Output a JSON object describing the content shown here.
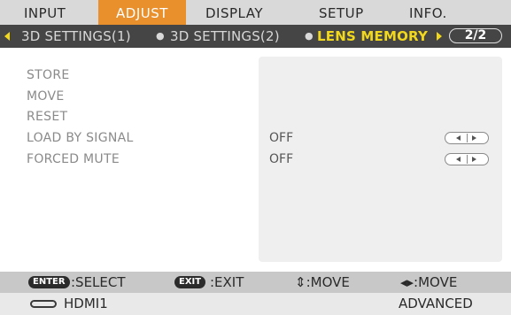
{
  "tabs": [
    {
      "label": "INPUT",
      "active": false
    },
    {
      "label": "ADJUST",
      "active": true
    },
    {
      "label": "DISPLAY",
      "active": false
    },
    {
      "label": "SETUP",
      "active": false
    },
    {
      "label": "INFO.",
      "active": false
    }
  ],
  "subtabs": [
    {
      "label": "3D SETTINGS(1)",
      "active": false
    },
    {
      "label": "3D SETTINGS(2)",
      "active": false
    },
    {
      "label": "LENS MEMORY",
      "active": true
    }
  ],
  "page_indicator": "2/2",
  "menu": {
    "items": [
      {
        "label": "STORE"
      },
      {
        "label": "MOVE"
      },
      {
        "label": "RESET"
      },
      {
        "label": "LOAD BY SIGNAL",
        "value": "OFF"
      },
      {
        "label": "FORCED MUTE",
        "value": "OFF"
      }
    ]
  },
  "help": {
    "enter_key": "ENTER",
    "enter_text": ":SELECT",
    "exit_key": "EXIT",
    "exit_text": ":EXIT",
    "move_ud_text": "⇕:MOVE",
    "move_lr_text": "◂▸:MOVE"
  },
  "status": {
    "input": "HDMI1",
    "mode": "ADVANCED"
  },
  "colors": {
    "active_tab": "#e98f2c",
    "active_subtab_text": "#f2d81c",
    "subbar_bg": "#454545"
  }
}
